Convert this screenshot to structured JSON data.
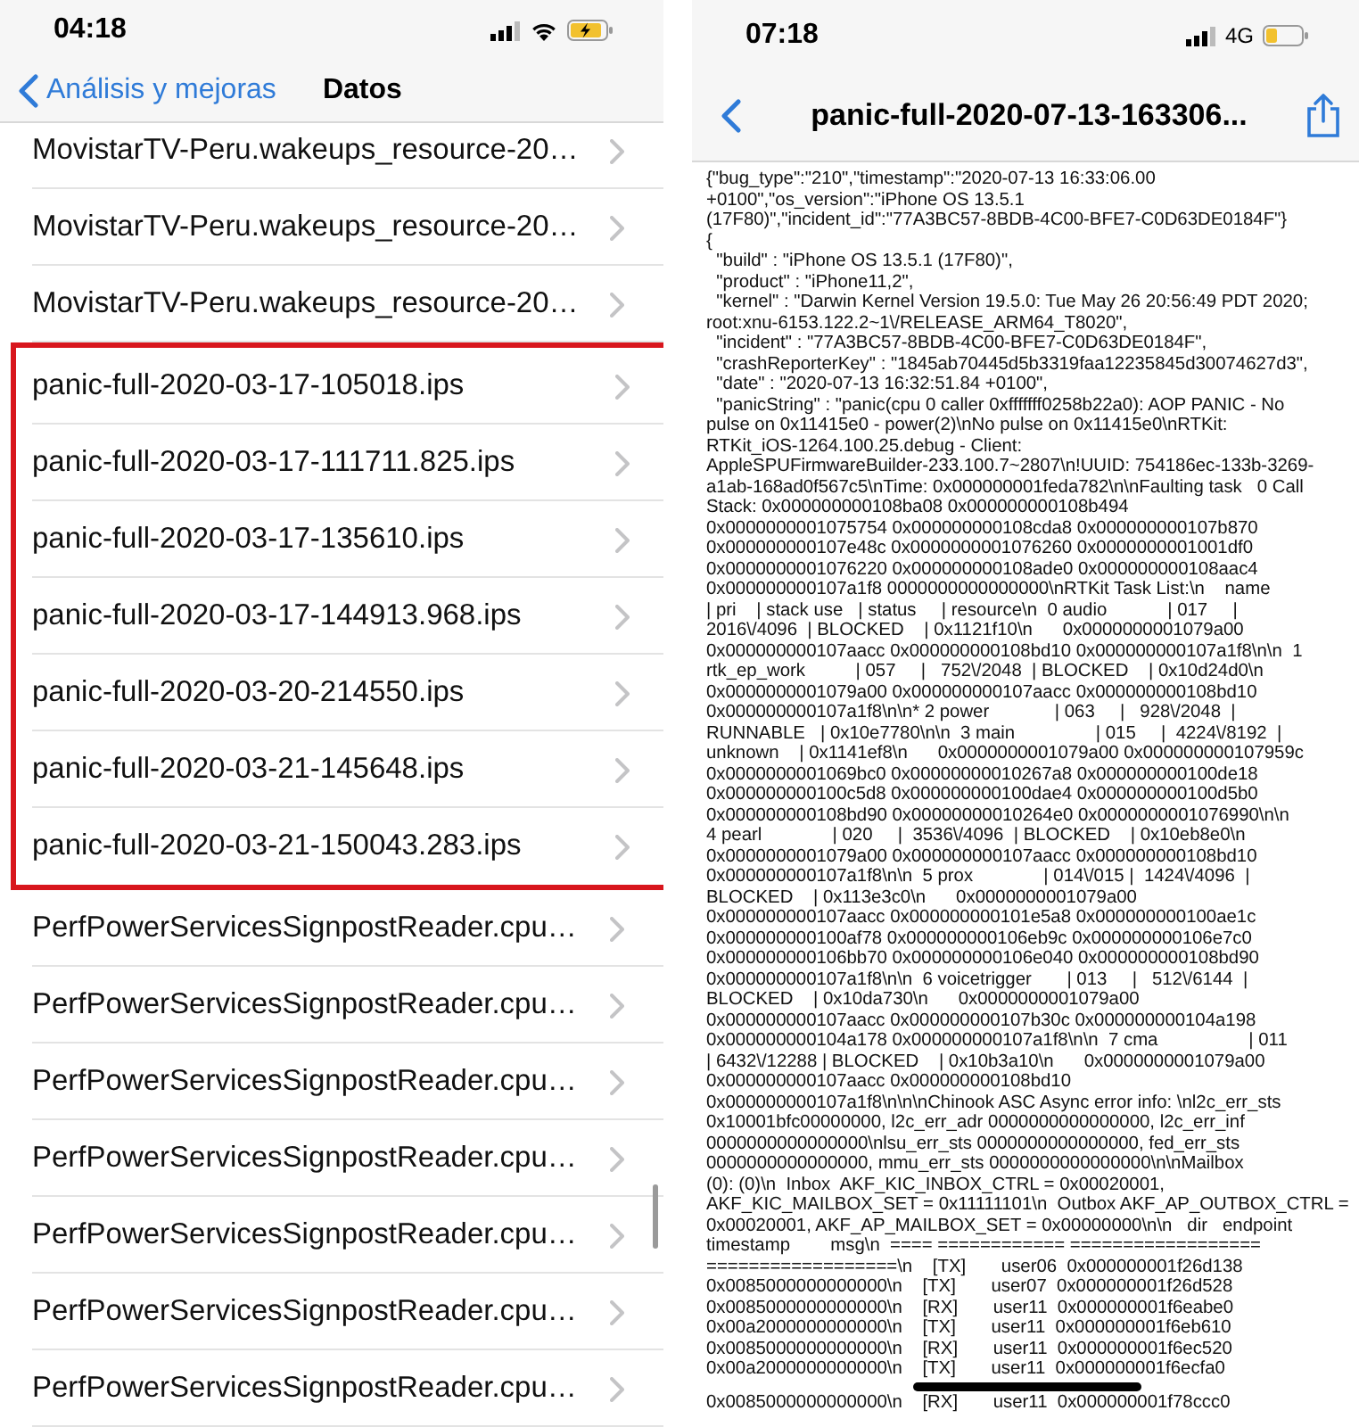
{
  "left_screen": {
    "status_bar": {
      "time": "04:18",
      "wifi": true,
      "charging": true,
      "low_power_mode": true
    },
    "nav": {
      "back_label": "Análisis y mejoras",
      "title": "Datos"
    },
    "files": [
      {
        "name": "MovistarTV-Peru.wakeups_resource-20…",
        "highlighted": false
      },
      {
        "name": "MovistarTV-Peru.wakeups_resource-20…",
        "highlighted": false
      },
      {
        "name": "MovistarTV-Peru.wakeups_resource-20…",
        "highlighted": false
      },
      {
        "name": "panic-full-2020-03-17-105018.ips",
        "highlighted": true
      },
      {
        "name": "panic-full-2020-03-17-111711.825.ips",
        "highlighted": true
      },
      {
        "name": "panic-full-2020-03-17-135610.ips",
        "highlighted": true
      },
      {
        "name": "panic-full-2020-03-17-144913.968.ips",
        "highlighted": true
      },
      {
        "name": "panic-full-2020-03-20-214550.ips",
        "highlighted": true
      },
      {
        "name": "panic-full-2020-03-21-145648.ips",
        "highlighted": true
      },
      {
        "name": "panic-full-2020-03-21-150043.283.ips",
        "highlighted": true
      },
      {
        "name": "PerfPowerServicesSignpostReader.cpu…",
        "highlighted": false
      },
      {
        "name": "PerfPowerServicesSignpostReader.cpu…",
        "highlighted": false
      },
      {
        "name": "PerfPowerServicesSignpostReader.cpu…",
        "highlighted": false
      },
      {
        "name": "PerfPowerServicesSignpostReader.cpu…",
        "highlighted": false
      },
      {
        "name": "PerfPowerServicesSignpostReader.cpu…",
        "highlighted": false
      },
      {
        "name": "PerfPowerServicesSignpostReader.cpu…",
        "highlighted": false
      },
      {
        "name": "PerfPowerServicesSignpostReader.cpu…",
        "highlighted": false
      }
    ]
  },
  "right_screen": {
    "status_bar": {
      "time": "07:18",
      "network": "4G",
      "charging": false,
      "low_power_mode": true
    },
    "nav": {
      "title": "panic-full-2020-07-13-163306..."
    },
    "log_lines": [
      "{\"bug_type\":\"210\",\"timestamp\":\"2020-07-13 16:33:06.00",
      "+0100\",\"os_version\":\"iPhone OS 13.5.1",
      "(17F80)\",\"incident_id\":\"77A3BC57-8BDB-4C00-BFE7-C0D63DE0184F\"}",
      "{",
      "  \"build\" : \"iPhone OS 13.5.1 (17F80)\",",
      "  \"product\" : \"iPhone11,2\",",
      "  \"kernel\" : \"Darwin Kernel Version 19.5.0: Tue May 26 20:56:49 PDT 2020;",
      "root:xnu-6153.122.2~1\\/RELEASE_ARM64_T8020\",",
      "  \"incident\" : \"77A3BC57-8BDB-4C00-BFE7-C0D63DE0184F\",",
      "  \"crashReporterKey\" : \"1845ab70445d5b3319faa12235845d30074627d3\",",
      "  \"date\" : \"2020-07-13 16:32:51.84 +0100\",",
      "  \"panicString\" : \"panic(cpu 0 caller 0xfffffff0258b22a0): AOP PANIC - No",
      "pulse on 0x11415e0 - power(2)\\nNo pulse on 0x11415e0\\nRTKit:",
      "RTKit_iOS-1264.100.25.debug - Client:",
      "AppleSPUFirmwareBuilder-233.100.7~2807\\n!UUID: 754186ec-133b-3269-",
      "a1ab-168ad0f567c5\\nTime: 0x000000001feda782\\n\\nFaulting task   0 Call",
      "Stack: 0x000000000108ba08 0x000000000108b494",
      "0x0000000001075754 0x000000000108cda8 0x000000000107b870",
      "0x000000000107e48c 0x0000000001076260 0x0000000001001df0",
      "0x0000000001076220 0x000000000108ade0 0x000000000108aac4",
      "0x000000000107a1f8 0000000000000000\\nRTKit Task List:\\n    name",
      "| pri    | stack use   | status     | resource\\n  0 audio            | 017     |",
      "2016\\/4096  | BLOCKED    | 0x1121f10\\n      0x0000000001079a00",
      "0x000000000107aacc 0x000000000108bd10 0x000000000107a1f8\\n\\n  1",
      "rtk_ep_work          | 057     |   752\\/2048  | BLOCKED    | 0x10d24d0\\n",
      "0x0000000001079a00 0x000000000107aacc 0x000000000108bd10",
      "0x000000000107a1f8\\n\\n* 2 power             | 063     |   928\\/2048  |",
      "RUNNABLE   | 0x10e7780\\n\\n  3 main                | 015     |  4224\\/8192  |",
      "unknown    | 0x1141ef8\\n      0x0000000001079a00 0x000000000107959c",
      "0x0000000001069bc0 0x00000000010267a8 0x000000000100de18",
      "0x000000000100c5d8 0x000000000100dae4 0x000000000100d5b0",
      "0x000000000108bd90 0x00000000010264e0 0x0000000001076990\\n\\n",
      "4 pearl              | 020     |  3536\\/4096  | BLOCKED    | 0x10eb8e0\\n",
      "0x0000000001079a00 0x000000000107aacc 0x000000000108bd10",
      "0x000000000107a1f8\\n\\n  5 prox              | 014\\/015 |  1424\\/4096  |",
      "BLOCKED    | 0x113e3c0\\n      0x0000000001079a00",
      "0x000000000107aacc 0x000000000101e5a8 0x000000000100ae1c",
      "0x000000000100af78 0x000000000106eb9c 0x000000000106e7c0",
      "0x000000000106bb70 0x000000000106e040 0x000000000108bd90",
      "0x000000000107a1f8\\n\\n  6 voicetrigger       | 013     |   512\\/6144  |",
      "BLOCKED    | 0x10da730\\n      0x0000000001079a00",
      "0x000000000107aacc 0x000000000107b30c 0x000000000104a198",
      "0x000000000104a178 0x000000000107a1f8\\n\\n  7 cma                  | 011",
      "| 6432\\/12288 | BLOCKED    | 0x10b3a10\\n      0x0000000001079a00",
      "0x000000000107aacc 0x000000000108bd10",
      "0x000000000107a1f8\\n\\n\\nChinook ASC Async error info: \\nl2c_err_sts",
      "0x10001bfc00000000, l2c_err_adr 0000000000000000, l2c_err_inf",
      "0000000000000000\\nlsu_err_sts 0000000000000000, fed_err_sts",
      "0000000000000000, mmu_err_sts 0000000000000000\\n\\nMailbox",
      "(0): (0)\\n  Inbox  AKF_KIC_INBOX_CTRL = 0x00020001,",
      "AKF_KIC_MAILBOX_SET = 0x11111101\\n  Outbox AKF_AP_OUTBOX_CTRL =",
      "0x00020001, AKF_AP_MAILBOX_SET = 0x00000000\\n\\n   dir   endpoint",
      "timestamp        msg\\n  ==== ============ ==================",
      "==================\\n    [TX]       user06  0x000000001f26d138",
      "0x0085000000000000\\n    [TX]       user07  0x000000001f26d528",
      "0x0085000000000000\\n    [RX]       user11  0x000000001f6eabe0",
      "0x00a2000000000000\\n    [TX]       user11  0x000000001f6eb610",
      "0x0085000000000000\\n    [RX]       user11  0x000000001f6ec520",
      "0x00a2000000000000\\n    [TX]       user11  0x000000001f6ecfa0",
      "0x0085000000000000\\n    [RX]       user11  0x000000001f78ccc0"
    ]
  }
}
